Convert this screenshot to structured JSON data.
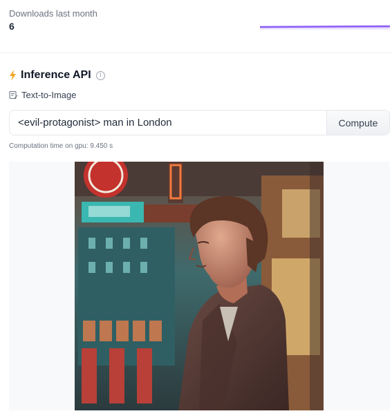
{
  "downloads": {
    "label": "Downloads last month",
    "count": "6"
  },
  "inference": {
    "title": "Inference API",
    "info_icon": "info-icon",
    "bolt_icon": "lightning-bolt-icon",
    "task_icon": "text-to-image-icon",
    "task_label": "Text-to-Image",
    "prompt_value": "<evil-protagonist> man in London",
    "compute_label": "Compute",
    "computation_time": "Computation time on gpu: 9.450 s"
  },
  "colors": {
    "accent_bolt": "#f5a623",
    "sparkline": "#8b5cf6"
  }
}
